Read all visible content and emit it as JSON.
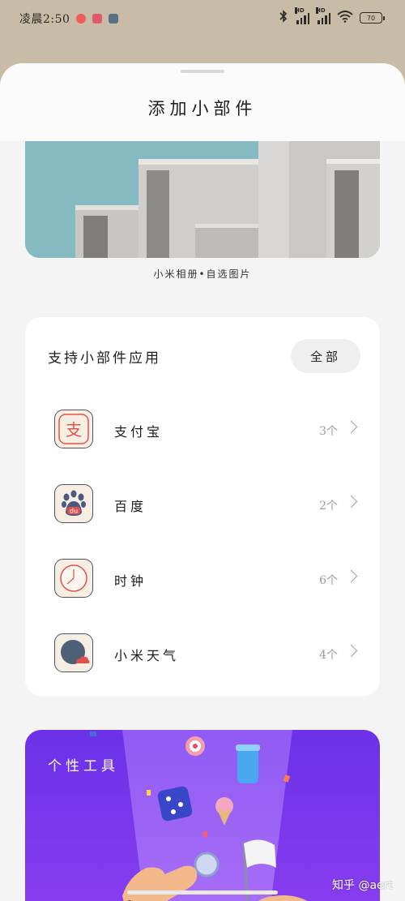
{
  "status_bar": {
    "time": "凌晨2:50",
    "net_label_1": "HD",
    "net_label_2": "HD",
    "battery": "70"
  },
  "sheet": {
    "title": "添加小部件"
  },
  "photo_widget": {
    "caption": "小米相册•自选图片"
  },
  "apps_section": {
    "title": "支持小部件应用",
    "all_button": "全部",
    "apps": [
      {
        "name": "支付宝",
        "count": "3个",
        "icon": "alipay-icon",
        "icon_glyph": "支"
      },
      {
        "name": "百度",
        "count": "2个",
        "icon": "baidu-icon",
        "icon_glyph": "du"
      },
      {
        "name": "时钟",
        "count": "6个",
        "icon": "clock-icon"
      },
      {
        "name": "小米天气",
        "count": "4个",
        "icon": "weather-icon"
      }
    ]
  },
  "tools_section": {
    "title": "个性工具"
  },
  "watermark": "知乎 @aert",
  "colors": {
    "accent_purple": "#7b3cf0",
    "icon_bg": "#f7eee3",
    "icon_border": "#4a5563",
    "alipay_red": "#e0534b"
  }
}
